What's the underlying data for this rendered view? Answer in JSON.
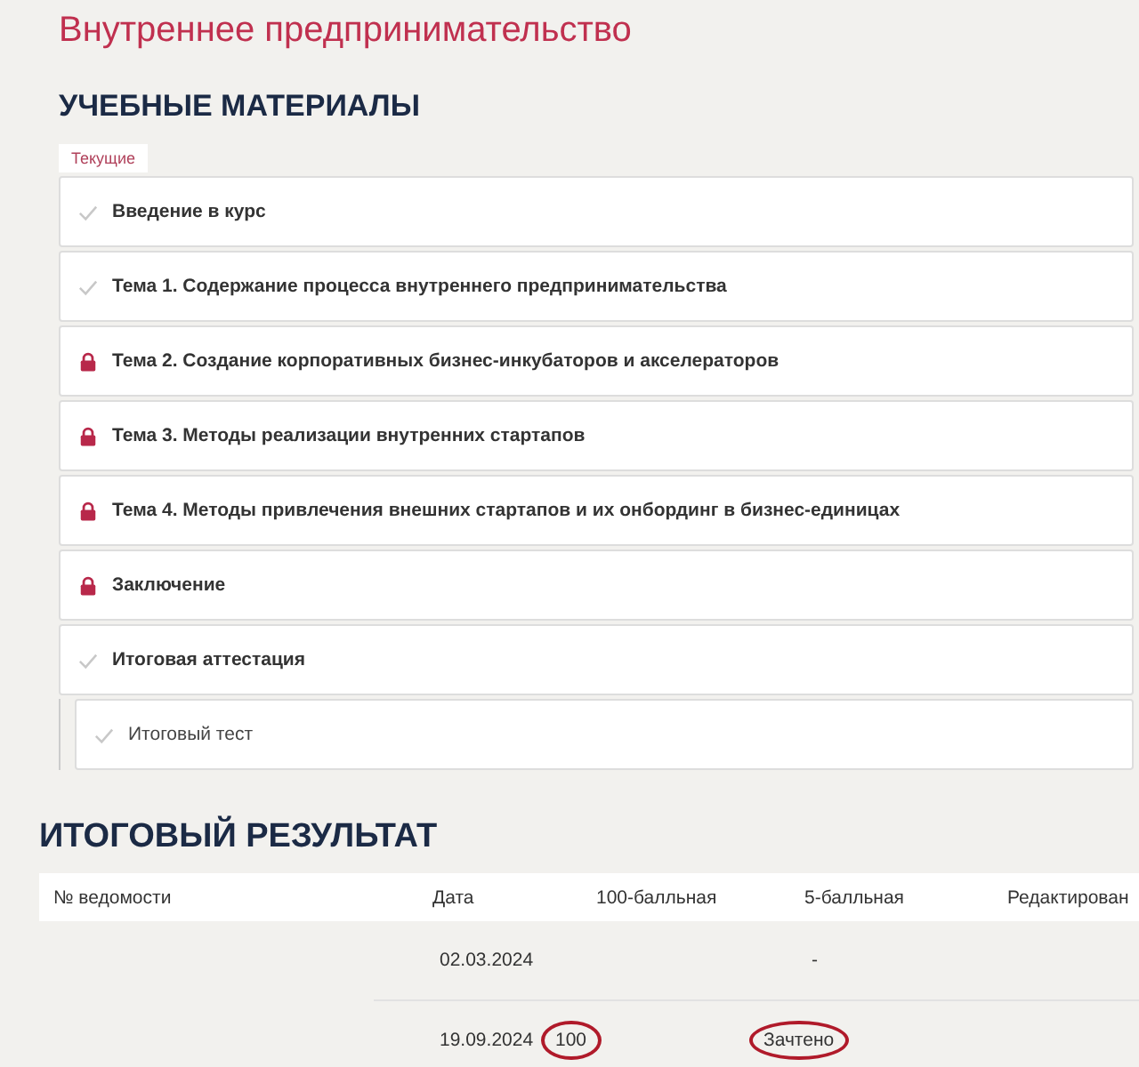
{
  "page_title": "Внутреннее предпринимательство",
  "materials": {
    "heading": "УЧЕБНЫЕ МАТЕРИАЛЫ",
    "tabs": [
      {
        "label": "Текущие",
        "selected": true
      }
    ],
    "items": [
      {
        "kind": "done",
        "label": "Введение в курс"
      },
      {
        "kind": "done",
        "label": "Тема 1. Содержание процесса внутреннего предпринимательства"
      },
      {
        "kind": "locked",
        "label": "Тема 2. Создание корпоративных бизнес-инкубаторов и акселераторов"
      },
      {
        "kind": "locked",
        "label": "Тема 3. Методы реализации внутренних стартапов"
      },
      {
        "kind": "locked",
        "label": "Тема 4. Методы привлечения внешних стартапов и их онбординг в бизнес-единицах"
      },
      {
        "kind": "locked",
        "label": "Заключение"
      },
      {
        "kind": "done",
        "label": "Итоговая аттестация",
        "children": [
          {
            "kind": "done",
            "label": "Итоговый тест"
          }
        ]
      }
    ]
  },
  "result": {
    "heading": "ИТОГОВЫЙ РЕЗУЛЬТАТ",
    "columns": [
      "№ ведомости",
      "Дата",
      "100-балльная",
      "5-балльная",
      "Редактирован"
    ],
    "rows": [
      {
        "date": {
          "text": "02.03.2024",
          "circled": false
        },
        "score_5": {
          "text": "-",
          "circled": false
        }
      },
      {
        "date": {
          "text": "19.09.2024",
          "circled": false
        },
        "score_100": {
          "text": "100",
          "circled": true
        },
        "score_5": {
          "text": "Зачтено",
          "circled": true
        }
      }
    ]
  }
}
